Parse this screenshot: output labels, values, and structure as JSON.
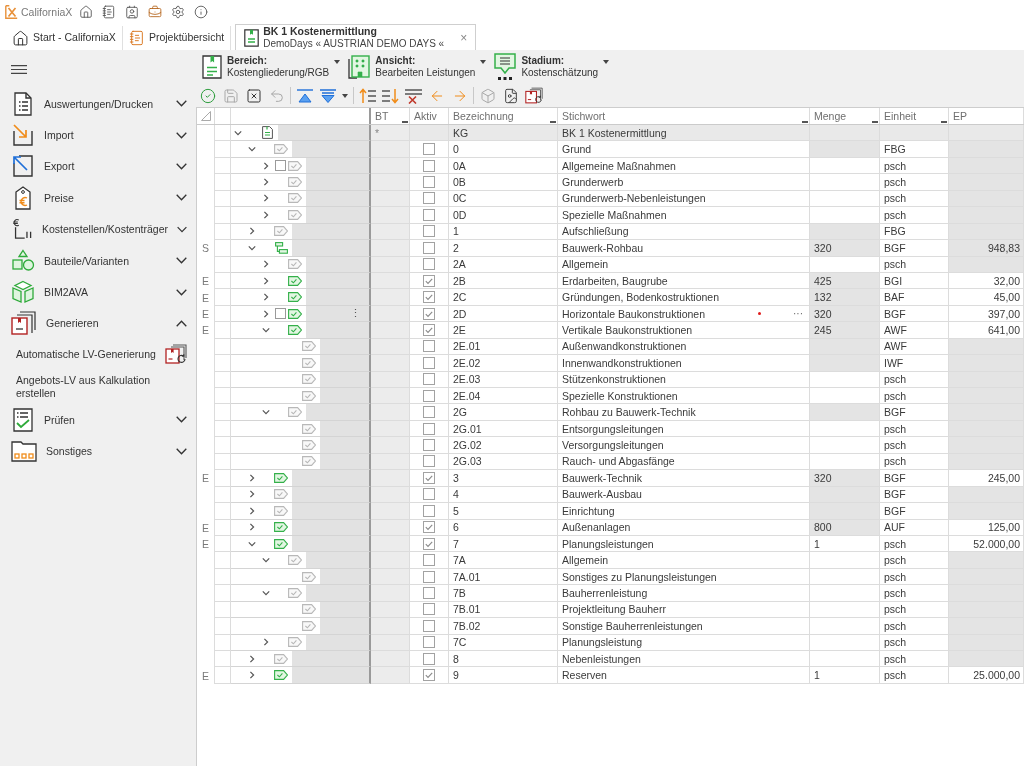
{
  "app": {
    "title": "CaliforniaX"
  },
  "tabs": [
    {
      "label": "Start - CaliforniaX",
      "selected": false
    },
    {
      "label": "Projektübersicht",
      "selected": false
    },
    {
      "label": "BK 1 Kostenermittlung",
      "subtitle": "DemoDays « AUSTRIAN DEMO DAYS «",
      "selected": true,
      "close": "×"
    }
  ],
  "sidebar": {
    "items": [
      {
        "label": "Auswertungen/Drucken",
        "expanded": false
      },
      {
        "label": "Import",
        "expanded": false
      },
      {
        "label": "Export",
        "expanded": false
      },
      {
        "label": "Preise",
        "expanded": false
      },
      {
        "label": "Kostenstellen/Kostenträger",
        "expanded": false
      },
      {
        "label": "Bauteile/Varianten",
        "expanded": false
      },
      {
        "label": "BIM2AVA",
        "expanded": false
      },
      {
        "label": "Generieren",
        "expanded": true,
        "children": [
          {
            "label": "Automatische LV-Generierung",
            "kind": "with_icon"
          },
          {
            "label": "Angebots-LV aus Kalkulation erstellen",
            "kind": "text"
          }
        ]
      },
      {
        "label": "Prüfen",
        "expanded": false
      },
      {
        "label": "Sonstiges",
        "expanded": false
      }
    ]
  },
  "selectors": [
    {
      "label": "Bereich:",
      "value": "Kostengliederung/RGB"
    },
    {
      "label": "Ansicht:",
      "value": "Bearbeiten Leistungen"
    },
    {
      "label": "Stadium:",
      "value": "Kostenschätzung"
    }
  ],
  "table": {
    "columns": [
      {
        "label": "BT",
        "filter_mark": true
      },
      {
        "label": "Aktiv",
        "filter_mark": false
      },
      {
        "label": "Bezeichnung",
        "filter_mark": true
      },
      {
        "label": "Stichwort",
        "filter_mark": true
      },
      {
        "label": "Menge",
        "filter_mark": true
      },
      {
        "label": "Einheit",
        "filter_mark": true
      },
      {
        "label": "EP",
        "filter_mark": false
      }
    ],
    "rows": [
      {
        "kind": "root",
        "expanded": true,
        "bt": "*",
        "code": "KG",
        "keyword": "BK 1 Kostenermittlung",
        "children": [
          {
            "kind": "group",
            "expanded": true,
            "active": false,
            "code": "0",
            "keyword": "Grund",
            "unit": "FBG",
            "quantity_readonly": true,
            "price_readonly": true,
            "children": [
              {
                "kind": "group",
                "expanded": false,
                "select_box": true,
                "active": false,
                "code": "0A",
                "keyword": "Allgemeine Maßnahmen",
                "unit": "psch",
                "quantity_readonly": false,
                "price_readonly": true
              },
              {
                "kind": "group",
                "expanded": false,
                "active": false,
                "code": "0B",
                "keyword": "Grunderwerb",
                "unit": "psch",
                "quantity_readonly": false,
                "price_readonly": true
              },
              {
                "kind": "group",
                "expanded": false,
                "active": false,
                "code": "0C",
                "keyword": "Grunderwerb-Nebenleistungen",
                "unit": "psch",
                "quantity_readonly": false,
                "price_readonly": true
              },
              {
                "kind": "group",
                "expanded": false,
                "active": false,
                "code": "0D",
                "keyword": "Spezielle Maßnahmen",
                "unit": "psch",
                "quantity_readonly": false,
                "price_readonly": true
              }
            ]
          },
          {
            "kind": "group",
            "expanded": false,
            "active": false,
            "code": "1",
            "keyword": "Aufschließung",
            "unit": "FBG",
            "quantity_readonly": true,
            "price_readonly": true
          },
          {
            "kind": "summary",
            "expanded": true,
            "marker": "S",
            "active": false,
            "code": "2",
            "keyword": "Bauwerk-Rohbau",
            "quantity": "320",
            "unit": "BGF",
            "price": "948,83",
            "quantity_readonly": true,
            "price_readonly": true,
            "children": [
              {
                "kind": "group",
                "expanded": false,
                "active": false,
                "code": "2A",
                "keyword": "Allgemein",
                "unit": "psch",
                "quantity_readonly": false,
                "price_readonly": true
              },
              {
                "kind": "group",
                "expanded": false,
                "marker": "E",
                "active": true,
                "code": "2B",
                "keyword": "Erdarbeiten, Baugrube",
                "quantity": "425",
                "unit": "BGI",
                "price": "32,00",
                "quantity_readonly": true,
                "price_readonly": false
              },
              {
                "kind": "group",
                "expanded": false,
                "marker": "E",
                "active": true,
                "code": "2C",
                "keyword": "Gründungen, Bodenkostruktionen",
                "quantity": "132",
                "unit": "BAF",
                "price": "45,00",
                "quantity_readonly": true,
                "price_readonly": false
              },
              {
                "kind": "group",
                "expanded": false,
                "marker": "E",
                "select_box": true,
                "row_menu": "⋮",
                "active": true,
                "code": "2D",
                "keyword": "Horizontale Baukonstruktionen",
                "dot_mark": true,
                "edit_button": "···",
                "quantity": "320",
                "unit": "BGF",
                "price": "397,00",
                "quantity_readonly": true,
                "price_readonly": false
              },
              {
                "kind": "group",
                "expanded": true,
                "marker": "E",
                "active": true,
                "code": "2E",
                "keyword": "Vertikale Baukonstruktionen",
                "quantity": "245",
                "unit": "AWF",
                "price": "641,00",
                "quantity_readonly": true,
                "price_readonly": false,
                "children": [
                  {
                    "kind": "leaf",
                    "active": false,
                    "code": "2E.01",
                    "keyword": "Außenwandkonstruktionen",
                    "unit": "AWF",
                    "quantity_readonly": true,
                    "price_readonly": true
                  },
                  {
                    "kind": "leaf",
                    "active": false,
                    "code": "2E.02",
                    "keyword": "Innenwandkonstruktionen",
                    "unit": "IWF",
                    "quantity_readonly": true,
                    "price_readonly": true
                  },
                  {
                    "kind": "leaf",
                    "active": false,
                    "code": "2E.03",
                    "keyword": "Stützenkonstruktionen",
                    "unit": "psch",
                    "quantity_readonly": false,
                    "price_readonly": true
                  },
                  {
                    "kind": "leaf",
                    "active": false,
                    "code": "2E.04",
                    "keyword": "Spezielle Konstruktionen",
                    "unit": "psch",
                    "quantity_readonly": false,
                    "price_readonly": true
                  }
                ]
              },
              {
                "kind": "group",
                "expanded": true,
                "active": false,
                "code": "2G",
                "keyword": "Rohbau zu Bauwerk-Technik",
                "unit": "BGF",
                "quantity_readonly": true,
                "price_readonly": true,
                "children": [
                  {
                    "kind": "leaf",
                    "active": false,
                    "code": "2G.01",
                    "keyword": "Entsorgungsleitungen",
                    "unit": "psch",
                    "quantity_readonly": false,
                    "price_readonly": true
                  },
                  {
                    "kind": "leaf",
                    "active": false,
                    "code": "2G.02",
                    "keyword": "Versorgungsleitungen",
                    "unit": "psch",
                    "quantity_readonly": false,
                    "price_readonly": true
                  },
                  {
                    "kind": "leaf",
                    "active": false,
                    "code": "2G.03",
                    "keyword": "Rauch- und Abgasfänge",
                    "unit": "psch",
                    "quantity_readonly": false,
                    "price_readonly": true
                  }
                ]
              }
            ]
          },
          {
            "kind": "group",
            "expanded": false,
            "marker": "E",
            "active": true,
            "code": "3",
            "keyword": "Bauwerk-Technik",
            "quantity": "320",
            "unit": "BGF",
            "price": "245,00",
            "quantity_readonly": true,
            "price_readonly": false
          },
          {
            "kind": "group",
            "expanded": false,
            "active": false,
            "code": "4",
            "keyword": "Bauwerk-Ausbau",
            "unit": "BGF",
            "quantity_readonly": true,
            "price_readonly": true
          },
          {
            "kind": "group",
            "expanded": false,
            "active": false,
            "code": "5",
            "keyword": "Einrichtung",
            "unit": "BGF",
            "quantity_readonly": true,
            "price_readonly": true
          },
          {
            "kind": "group",
            "expanded": false,
            "marker": "E",
            "active": true,
            "code": "6",
            "keyword": "Außenanlagen",
            "quantity": "800",
            "unit": "AUF",
            "price": "125,00",
            "quantity_readonly": true,
            "price_readonly": false
          },
          {
            "kind": "group",
            "expanded": true,
            "marker": "E",
            "active": true,
            "code": "7",
            "keyword": "Planungsleistungen",
            "quantity": "1",
            "unit": "psch",
            "price": "52.000,00",
            "quantity_readonly": false,
            "price_readonly": false,
            "children": [
              {
                "kind": "group",
                "expanded": true,
                "active": false,
                "code": "7A",
                "keyword": "Allgemein",
                "unit": "psch",
                "quantity_readonly": false,
                "price_readonly": true,
                "children": [
                  {
                    "kind": "leaf",
                    "active": false,
                    "code": "7A.01",
                    "keyword": "Sonstiges zu Planungsleistungen",
                    "unit": "psch",
                    "quantity_readonly": false,
                    "price_readonly": true
                  }
                ]
              },
              {
                "kind": "group",
                "expanded": true,
                "active": false,
                "code": "7B",
                "keyword": "Bauherrenleistung",
                "unit": "psch",
                "quantity_readonly": false,
                "price_readonly": true,
                "children": [
                  {
                    "kind": "leaf",
                    "active": false,
                    "code": "7B.01",
                    "keyword": "Projektleitung Bauherr",
                    "unit": "psch",
                    "quantity_readonly": false,
                    "price_readonly": true
                  },
                  {
                    "kind": "leaf",
                    "active": false,
                    "code": "7B.02",
                    "keyword": "Sonstige Bauherrenleistungen",
                    "unit": "psch",
                    "quantity_readonly": false,
                    "price_readonly": true
                  }
                ]
              },
              {
                "kind": "group",
                "expanded": false,
                "active": false,
                "code": "7C",
                "keyword": "Planungsleistung",
                "unit": "psch",
                "quantity_readonly": false,
                "price_readonly": true
              }
            ]
          },
          {
            "kind": "group",
            "expanded": false,
            "active": false,
            "code": "8",
            "keyword": "Nebenleistungen",
            "unit": "psch",
            "quantity_readonly": false,
            "price_readonly": true
          },
          {
            "kind": "group",
            "expanded": false,
            "marker": "E",
            "active": true,
            "code": "9",
            "keyword": "Reserven",
            "quantity": "1",
            "unit": "psch",
            "price": "25.000,00",
            "quantity_readonly": false,
            "price_readonly": false
          }
        ]
      }
    ]
  }
}
